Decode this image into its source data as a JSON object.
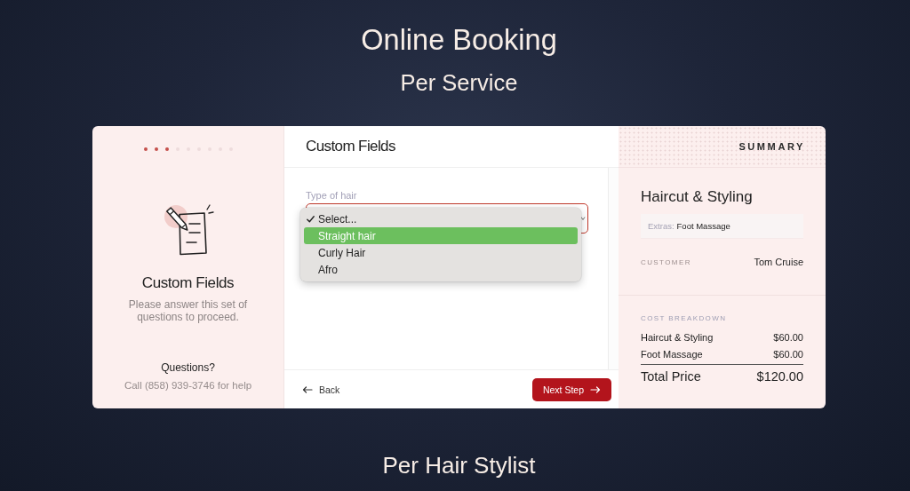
{
  "header": {
    "title": "Online Booking",
    "subtitle": "Per Service"
  },
  "sidebar": {
    "progress_dots": [
      {
        "completed": true
      },
      {
        "completed": true
      },
      {
        "completed": true
      },
      {
        "completed": false
      },
      {
        "completed": false
      },
      {
        "completed": false
      },
      {
        "completed": false
      },
      {
        "completed": false
      },
      {
        "completed": false
      }
    ],
    "title": "Custom Fields",
    "description": "Please answer this set of questions to proceed.",
    "help_title": "Questions?",
    "help_text": "Call (858) 939-3746 for help"
  },
  "form": {
    "title": "Custom Fields",
    "field": {
      "label": "Type of hair",
      "invalid": true,
      "expanded": true,
      "options": [
        {
          "label": "Select...",
          "selected": true,
          "highlighted": false
        },
        {
          "label": "Straight hair",
          "selected": false,
          "highlighted": true
        },
        {
          "label": "Curly Hair",
          "selected": false,
          "highlighted": false
        },
        {
          "label": "Afro",
          "selected": false,
          "highlighted": false
        }
      ]
    },
    "back_button": "Back",
    "next_button": "Next Step"
  },
  "summary": {
    "heading": "SUMMARY",
    "service": "Haircut & Styling",
    "extras_label": "Extras:",
    "extras_value": "Foot Massage",
    "customer_label": "CUSTOMER",
    "customer_name": "Tom Cruise",
    "cost_heading": "COST BREAKDOWN",
    "line_items": [
      {
        "name": "Haircut & Styling",
        "price": "$60.00"
      },
      {
        "name": "Foot Massage",
        "price": "$60.00"
      }
    ],
    "total_label": "Total Price",
    "total_price": "$120.00"
  },
  "caption": "Per Hair Stylist"
}
